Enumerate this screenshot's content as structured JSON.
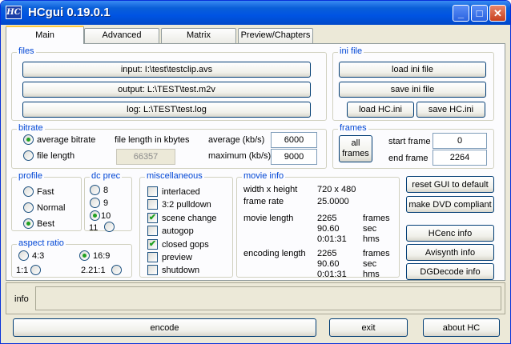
{
  "window": {
    "title": "HCgui 0.19.0.1",
    "icon_text": "HC",
    "controls": {
      "minimize": "_",
      "maximize": "□",
      "close": "✕"
    }
  },
  "tabs": [
    "Main",
    "Advanced",
    "Matrix",
    "Preview/Chapters"
  ],
  "files": {
    "title": "files",
    "input_label": "input: I:\\test\\testclip.avs",
    "output_label": "output: L:\\TEST\\test.m2v",
    "log_label": "log: L:\\TEST\\test.log"
  },
  "ini": {
    "title": "ini file",
    "load_label": "load ini file",
    "save_label": "save ini file",
    "load_hc_label": "load HC.ini",
    "save_hc_label": "save HC.ini"
  },
  "bitrate": {
    "title": "bitrate",
    "average_bitrate": "average bitrate",
    "file_length": "file length",
    "file_length_kb_label": "file length in kbytes",
    "file_length_value": "66357",
    "average_label": "average (kb/s)",
    "average_value": "6000",
    "maximum_label": "maximum (kb/s)",
    "maximum_value": "9000"
  },
  "frames": {
    "title": "frames",
    "all_frames_line1": "all",
    "all_frames_line2": "frames",
    "start_label": "start frame",
    "start_value": "0",
    "end_label": "end frame",
    "end_value": "2264"
  },
  "profile": {
    "title": "profile",
    "options": [
      "Fast",
      "Normal",
      "Best"
    ],
    "selected": "Best"
  },
  "dc_prec": {
    "title": "dc prec",
    "options": [
      "8",
      "9",
      "10",
      "11"
    ],
    "selected": "10"
  },
  "aspect": {
    "title": "aspect ratio",
    "options": [
      "4:3",
      "16:9",
      "1:1",
      "2.21:1"
    ],
    "selected": "16:9"
  },
  "misc": {
    "title": "miscellaneous",
    "items": [
      {
        "label": "interlaced",
        "checked": false
      },
      {
        "label": "3:2 pulldown",
        "checked": false
      },
      {
        "label": "scene change",
        "checked": true
      },
      {
        "label": "autogop",
        "checked": false
      },
      {
        "label": "closed gops",
        "checked": true
      },
      {
        "label": "preview",
        "checked": false
      },
      {
        "label": "shutdown",
        "checked": false
      }
    ],
    "check_glyph": "✔"
  },
  "movie": {
    "title": "movie info",
    "wh_label": "width x height",
    "wh_value": "720 x 480",
    "fr_label": "frame rate",
    "fr_value": "25.0000",
    "ml_label": "movie length",
    "ml_frames": "2265",
    "ml_sec": "90.60",
    "ml_hms": "0:01:31",
    "el_label": "encoding length",
    "el_frames": "2265",
    "el_sec": "90.60",
    "el_hms": "0:01:31",
    "unit_frames": "frames",
    "unit_sec": "sec",
    "unit_hms": "hms"
  },
  "side_buttons": {
    "reset": "reset GUI to default",
    "dvd": "make DVD compliant",
    "hcenc": "HCenc info",
    "avisynth": "Avisynth info",
    "dgdecode": "DGDecode info"
  },
  "info": {
    "label": "info"
  },
  "bottom": {
    "encode": "encode",
    "exit": "exit",
    "about": "about HC"
  }
}
